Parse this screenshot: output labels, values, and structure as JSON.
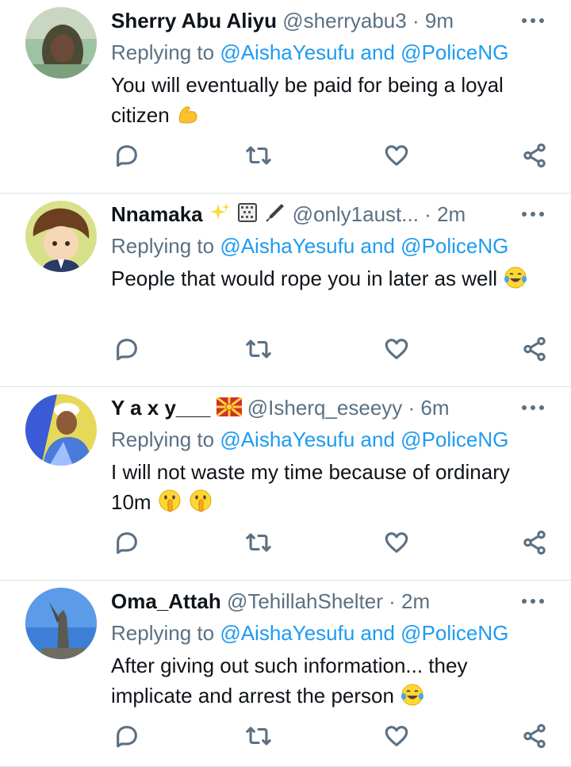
{
  "tweets": [
    {
      "name": "Sherry Abu Aliyu",
      "name_emojis": "",
      "handle": "@sherryabu3",
      "time": "9m",
      "replying_label": "Replying to",
      "mention_1": "@AishaYesufu",
      "mention_join": "and",
      "mention_2": "@PoliceNG",
      "text": "You will eventually be paid for being a loyal citizen",
      "text_emoji": "flexed-biceps"
    },
    {
      "name": "Nnamaka",
      "name_emojis": "sparkles, abacus, pen",
      "handle": "@only1aust...",
      "time": "2m",
      "replying_label": "Replying to",
      "mention_1": "@AishaYesufu",
      "mention_join": "and",
      "mention_2": "@PoliceNG",
      "text": "People that would rope you in later as well",
      "text_emoji": "tears-of-joy"
    },
    {
      "name": "Y a x y___",
      "name_emojis": "flag-north-macedonia",
      "handle": "@Isherq_eseeyy",
      "time": "6m",
      "replying_label": "Replying to",
      "mention_1": "@AishaYesufu",
      "mention_join": "and",
      "mention_2": "@PoliceNG",
      "text": "I will not waste my time because of ordinary 10m",
      "text_emoji": "shushing-face, shushing-face"
    },
    {
      "name": "Oma_Attah",
      "name_emojis": "",
      "handle": "@TehillahShelter",
      "time": "2m",
      "replying_label": "Replying to",
      "mention_1": "@AishaYesufu",
      "mention_join": "and",
      "mention_2": "@PoliceNG",
      "text": "After giving out such information... they implicate and arrest the person",
      "text_emoji": "tears-of-joy"
    }
  ],
  "separator": "·",
  "colors": {
    "name": "#0f1419",
    "secondary": "#5b7083",
    "mention": "#1d9bf0",
    "divider": "#dfe3e6"
  }
}
